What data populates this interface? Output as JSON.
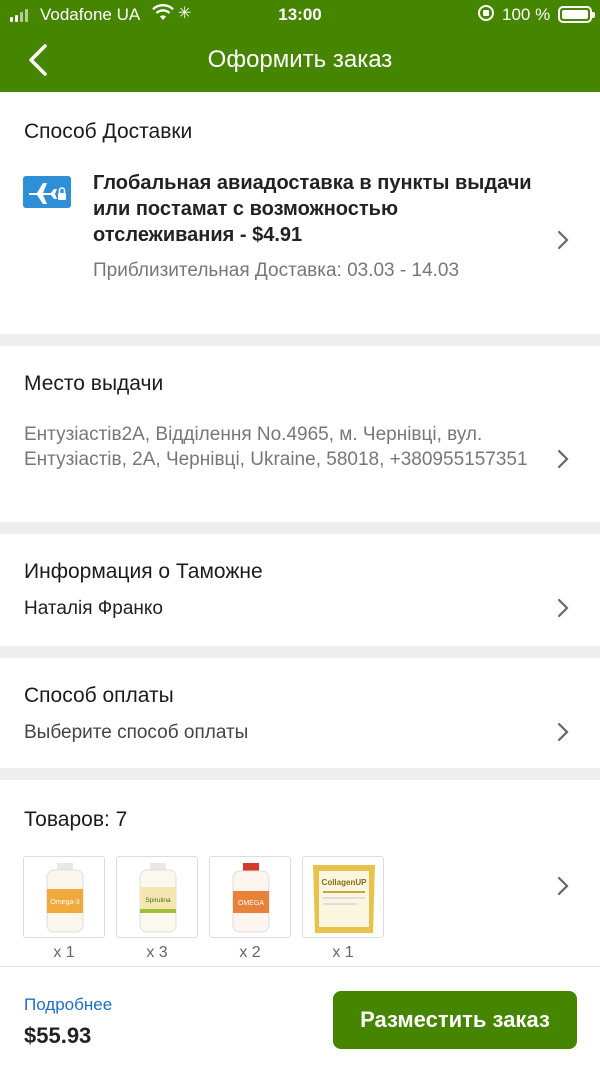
{
  "status_bar": {
    "carrier": "Vodafone UA",
    "time": "13:00",
    "battery": "100 %"
  },
  "header": {
    "title": "Оформить заказ",
    "back_icon": "chevron-left-icon"
  },
  "delivery": {
    "heading": "Способ Доставки",
    "method": "Глобальная авиадоставка в пункты выдачи или постамат с возможностью отслеживания - $4.91",
    "estimate": "Приблизительная Доставка: 03.03 - 14.03",
    "icon": "airplane-lock-icon"
  },
  "pickup": {
    "heading": "Место выдачи",
    "address": "Ентузіастів2А, Відділення No.4965, м. Чернівці, вул. Ентузіастів, 2А, Чернівці, Ukraine, 58018, +380955157351"
  },
  "customs": {
    "heading": "Информация о Таможне",
    "name": "Наталія Франко"
  },
  "payment": {
    "heading": "Способ оплаты",
    "placeholder": "Выберите способ оплаты"
  },
  "items": {
    "heading": "Товаров: 7",
    "products": [
      {
        "qty": "x 1",
        "color": "#f2a93b",
        "label": "Omega-3"
      },
      {
        "qty": "x 3",
        "color": "#9fbf3a",
        "label": "Spirulina"
      },
      {
        "qty": "x 2",
        "color": "#e8823a",
        "label": "OMEGA"
      },
      {
        "qty": "x 1",
        "color": "#e8c24a",
        "label": "CollagenUP"
      }
    ]
  },
  "footer": {
    "details_link": "Подробнее",
    "total": "$55.93",
    "place_order": "Разместить заказ"
  },
  "colors": {
    "brand_green": "#458500",
    "link_blue": "#1a6fc7",
    "icon_blue": "#2f8fd6"
  }
}
